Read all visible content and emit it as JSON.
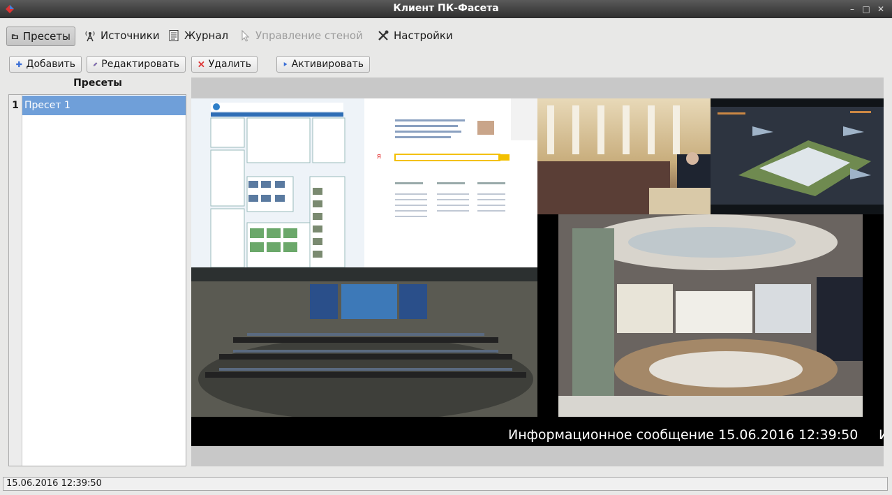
{
  "window": {
    "title": "Клиент ПК-Фасета"
  },
  "menu": {
    "presets": "Пресеты",
    "sources": "Источники",
    "journal": "Журнал",
    "wall_control": "Управление стеной",
    "settings": "Настройки"
  },
  "toolbar": {
    "add": "Добавить",
    "edit": "Редактировать",
    "delete": "Удалить",
    "activate": "Активировать"
  },
  "presets_panel": {
    "title": "Пресеты",
    "items": [
      {
        "number": "1",
        "name": "Пресет 1",
        "selected": true
      }
    ]
  },
  "preview": {
    "ticker_text": "Информационное сообщение 15.06.2016 12:39:50",
    "ticker_tail": "И",
    "tiles": [
      {
        "name": "weather-site",
        "brand": "gismeteo"
      },
      {
        "name": "search-engine",
        "brand": "Яндекс"
      },
      {
        "name": "hall-speech-photo"
      },
      {
        "name": "infographic-aircraft"
      },
      {
        "name": "mission-control-room"
      },
      {
        "name": "situation-center"
      }
    ]
  },
  "statusbar": {
    "text": "15.06.2016  12:39:50"
  },
  "colors": {
    "selection": "#6f9fd9",
    "titlebar": "#3a3a3a",
    "activate_icon": "#3b6fd6",
    "delete_icon": "#d33"
  }
}
